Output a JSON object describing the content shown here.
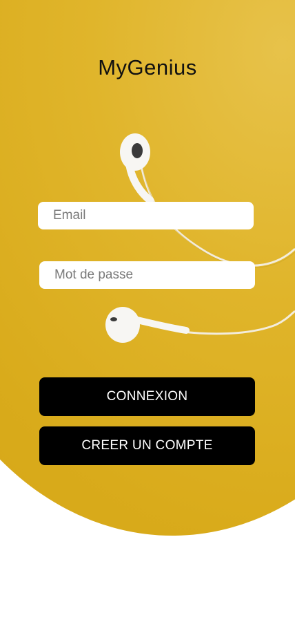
{
  "app": {
    "title": "MyGenius"
  },
  "form": {
    "email_placeholder": "Email",
    "password_placeholder": "Mot de passe",
    "login_label": "CONNEXION",
    "signup_label": "CREER UN COMPTE"
  },
  "colors": {
    "hero_yellow": "#dcae20",
    "button_bg": "#000000",
    "button_text": "#ffffff",
    "field_bg": "#ffffff"
  }
}
